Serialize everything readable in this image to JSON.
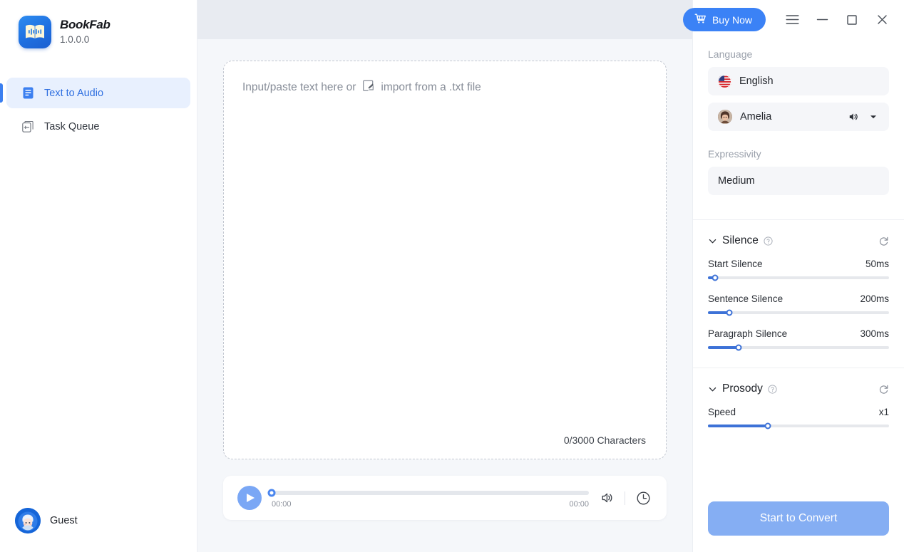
{
  "app": {
    "brand_name": "BookFab",
    "version": "1.0.0.0",
    "logo_icon": "open-book-audio-icon"
  },
  "sidebar": {
    "items": [
      {
        "label": "Text to Audio",
        "icon": "document-text-icon",
        "active": true
      },
      {
        "label": "Task Queue",
        "icon": "add-square-icon",
        "active": false
      }
    ],
    "user": {
      "name": "Guest",
      "avatar_icon": "user-avatar"
    }
  },
  "titlebar": {
    "buy_label": "Buy Now",
    "buy_icon": "shopping-cart-icon",
    "menu_icon": "hamburger-menu-icon",
    "minimize_icon": "minimize-icon",
    "maximize_icon": "maximize-icon",
    "close_icon": "close-icon",
    "accent_color": "#3b82f6"
  },
  "editor": {
    "placeholder_prefix": "Input/paste text here or",
    "import_label": "import from a .txt file",
    "import_icon": "file-import-icon",
    "value": "",
    "char_count": "0/3000 Characters"
  },
  "player": {
    "play_icon": "play-icon",
    "progress_percent": 0,
    "current_time": "00:00",
    "total_time": "00:00",
    "volume_icon": "volume-icon",
    "history_icon": "clock-history-icon"
  },
  "settings": {
    "language_label": "Language",
    "language_value": "English",
    "language_flag": "us-flag-icon",
    "voice_value": "Amelia",
    "voice_preview_icon": "speaker-icon",
    "voice_dropdown_icon": "chevron-down-icon",
    "expressivity_label": "Expressivity",
    "expressivity_value": "Medium",
    "silence": {
      "title": "Silence",
      "help_icon": "question-circle-icon",
      "reset_icon": "refresh-icon",
      "collapse_icon": "chevron-down-icon",
      "rows": [
        {
          "name": "Start Silence",
          "value": "50ms",
          "percent": 4
        },
        {
          "name": "Sentence Silence",
          "value": "200ms",
          "percent": 12
        },
        {
          "name": "Paragraph Silence",
          "value": "300ms",
          "percent": 17
        }
      ]
    },
    "prosody": {
      "title": "Prosody",
      "help_icon": "question-circle-icon",
      "reset_icon": "refresh-icon",
      "collapse_icon": "chevron-down-icon",
      "rows": [
        {
          "name": "Speed",
          "value": "x1",
          "percent": 33
        }
      ]
    },
    "convert_label": "Start to Convert"
  }
}
